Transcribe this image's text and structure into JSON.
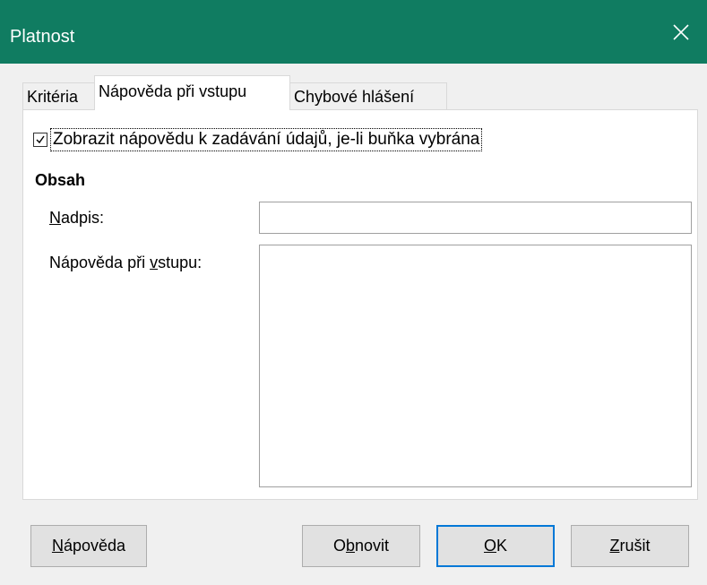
{
  "window": {
    "title": "Platnost",
    "close_icon": "close-icon"
  },
  "tabs": [
    {
      "label": "Kritéria",
      "active": false
    },
    {
      "label": "Nápověda při vstupu",
      "active": true
    },
    {
      "label": "Chybové hlášení",
      "active": false
    }
  ],
  "panel": {
    "checkbox": {
      "checked": true,
      "label": "Zobrazit nápovědu k zadávání údajů, je-li buňka vybrána"
    },
    "section_title": "Obsah",
    "title_field": {
      "label_mnemonic": "N",
      "label_rest": "adpis:",
      "value": ""
    },
    "help_field": {
      "label_before": "Nápověda při ",
      "label_mnemonic": "v",
      "label_after": "stupu:",
      "value": ""
    }
  },
  "buttons": {
    "help": {
      "mnemonic": "N",
      "rest": "ápověda"
    },
    "reset": {
      "before": "O",
      "mnemonic": "b",
      "after": "novit"
    },
    "ok": {
      "mnemonic": "O",
      "rest": "K"
    },
    "cancel": {
      "mnemonic": "Z",
      "rest": "rušit"
    }
  },
  "colors": {
    "titlebar": "#107c61",
    "default_button_border": "#0078d7"
  }
}
